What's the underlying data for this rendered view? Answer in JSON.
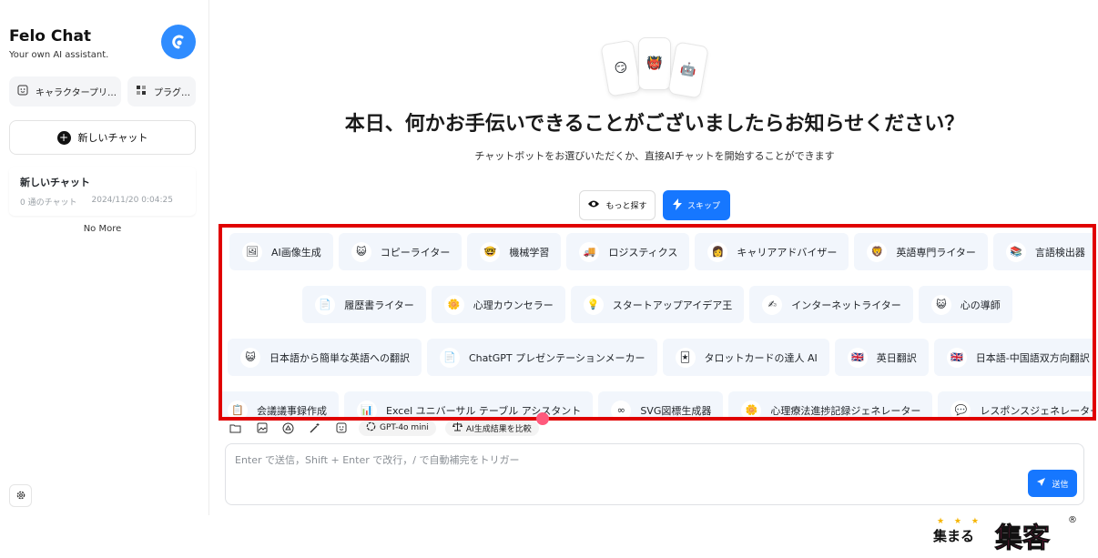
{
  "sidebar": {
    "title": "Felo Chat",
    "subtitle": "Your own AI assistant.",
    "character_button": "キャラクタープリ…",
    "plugin_button": "プラグ…",
    "new_chat": "新しいチャット",
    "chat_item": {
      "title": "新しいチャット",
      "count": "0 通のチャット",
      "date": "2024/11/20 0:04:25"
    },
    "no_more": "No More"
  },
  "main": {
    "headline": "本日、何かお手伝いできることがございましたらお知らせください？",
    "subline": "チャットボットをお選びいただくか、直接AIチャットを開始することができます",
    "more_button": "もっと探す",
    "skip_button": "スキップ",
    "bot_rows": [
      [
        {
          "label": "AI画像生成",
          "icon": "🖼"
        },
        {
          "label": "コピーライター",
          "icon": "😺"
        },
        {
          "label": "機械学習",
          "icon": "🤓"
        },
        {
          "label": "ロジスティクス",
          "icon": "🚚"
        },
        {
          "label": "キャリアアドバイザー",
          "icon": "👩"
        },
        {
          "label": "英語専門ライター",
          "icon": "🦁"
        },
        {
          "label": "言語検出器",
          "icon": "📚"
        }
      ],
      [
        {
          "label": "履歴書ライター",
          "icon": "📄"
        },
        {
          "label": "心理カウンセラー",
          "icon": "🌼"
        },
        {
          "label": "スタートアップアイデア王",
          "icon": "💡"
        },
        {
          "label": "インターネットライター",
          "icon": "✍"
        },
        {
          "label": "心の導師",
          "icon": "😺"
        }
      ],
      [
        {
          "label": "日本語から簡単な英語への翻訳",
          "icon": "😺"
        },
        {
          "label": "ChatGPT プレゼンテーションメーカー",
          "icon": "📄"
        },
        {
          "label": "タロットカードの達人 AI",
          "icon": "🃏"
        },
        {
          "label": "英日翻訳",
          "icon": "🇬🇧"
        },
        {
          "label": "日本語-中国語双方向翻訳",
          "icon": "🇬🇧"
        }
      ],
      [
        {
          "label": "会議議事録作成",
          "icon": "📋"
        },
        {
          "label": "Excel ユニバーサル テーブル アシスタント",
          "icon": "📊"
        },
        {
          "label": "SVG図標生成器",
          "icon": "∞"
        },
        {
          "label": "心理療法進捗記録ジェネレーター",
          "icon": "🌼"
        },
        {
          "label": "レスポンスジェネレーター",
          "icon": "💬"
        }
      ]
    ],
    "toolbar": {
      "model": "GPT-4o mini",
      "compare": "AI生成結果を比較"
    },
    "input_placeholder": "Enter で送信，Shift + Enter で改行，/ で自動補完をトリガー",
    "send_button": "送信"
  },
  "watermark": {
    "stars": "★ ★ ★",
    "left_text": "集まる",
    "big_text": "集客",
    "mark": "®"
  },
  "colors": {
    "accent": "#1677ff",
    "highlight_border": "#e00000",
    "chip_bg": "#f2f6fc"
  }
}
